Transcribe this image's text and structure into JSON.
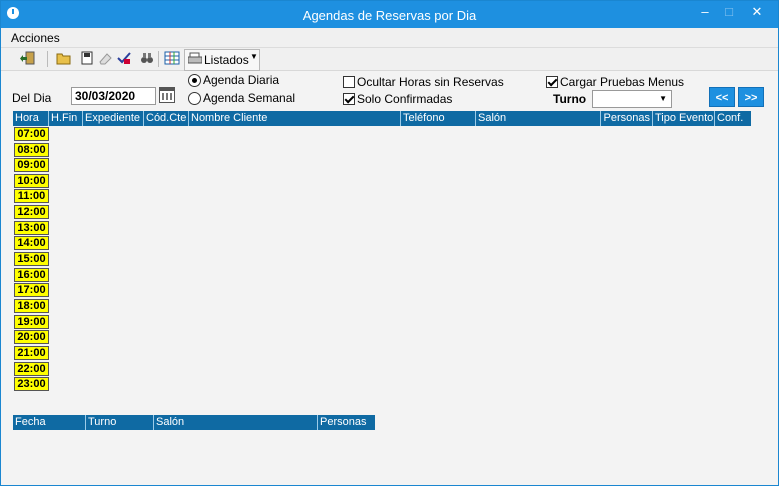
{
  "window": {
    "title": "Agendas de Reservas por Dia",
    "controls": {
      "minimize": "–",
      "maximize": "□",
      "close": "✕"
    }
  },
  "menu": {
    "acciones": "Acciones"
  },
  "toolbar": {
    "icons": [
      "exit-icon",
      "open-folder-icon",
      "save-icon",
      "eraser-icon",
      "check-icon",
      "binoculars-icon",
      "grid-icon",
      "printer-icon"
    ],
    "listados_label": "Listados"
  },
  "filters": {
    "del_dia_label": "Del Dia",
    "date_value": "30/03/2020",
    "agenda_diaria_label": "Agenda Diaria",
    "agenda_semanal_label": "Agenda Semanal",
    "agenda_mode_selected": "diaria",
    "ocultar_horas_label": "Ocultar Horas sin Reservas",
    "ocultar_horas_checked": false,
    "solo_confirmadas_label": "Solo Confirmadas",
    "solo_confirmadas_checked": true,
    "cargar_pruebas_label": "Cargar Pruebas Menus",
    "cargar_pruebas_checked": true,
    "turno_label": "Turno",
    "turno_value": "",
    "prev_label": "<<",
    "next_label": ">>"
  },
  "agenda_grid": {
    "columns": [
      "Hora",
      "H.Fin",
      "Expediente",
      "Cód.Cte",
      "Nombre Cliente",
      "Teléfono",
      "Salón",
      "Personas",
      "Tipo Evento",
      "Conf."
    ],
    "hours": [
      "07:00",
      "08:00",
      "09:00",
      "10:00",
      "11:00",
      "12:00",
      "13:00",
      "14:00",
      "15:00",
      "16:00",
      "17:00",
      "18:00",
      "19:00",
      "20:00",
      "21:00",
      "22:00",
      "23:00"
    ]
  },
  "detail_grid": {
    "columns": [
      "Fecha",
      "Turno",
      "Salón",
      "Personas"
    ]
  },
  "colors": {
    "title_bar": "#1e90e0",
    "grid_header": "#0f6aa3",
    "hour_cell": "#ffff00",
    "background": "#f3f3f3"
  }
}
